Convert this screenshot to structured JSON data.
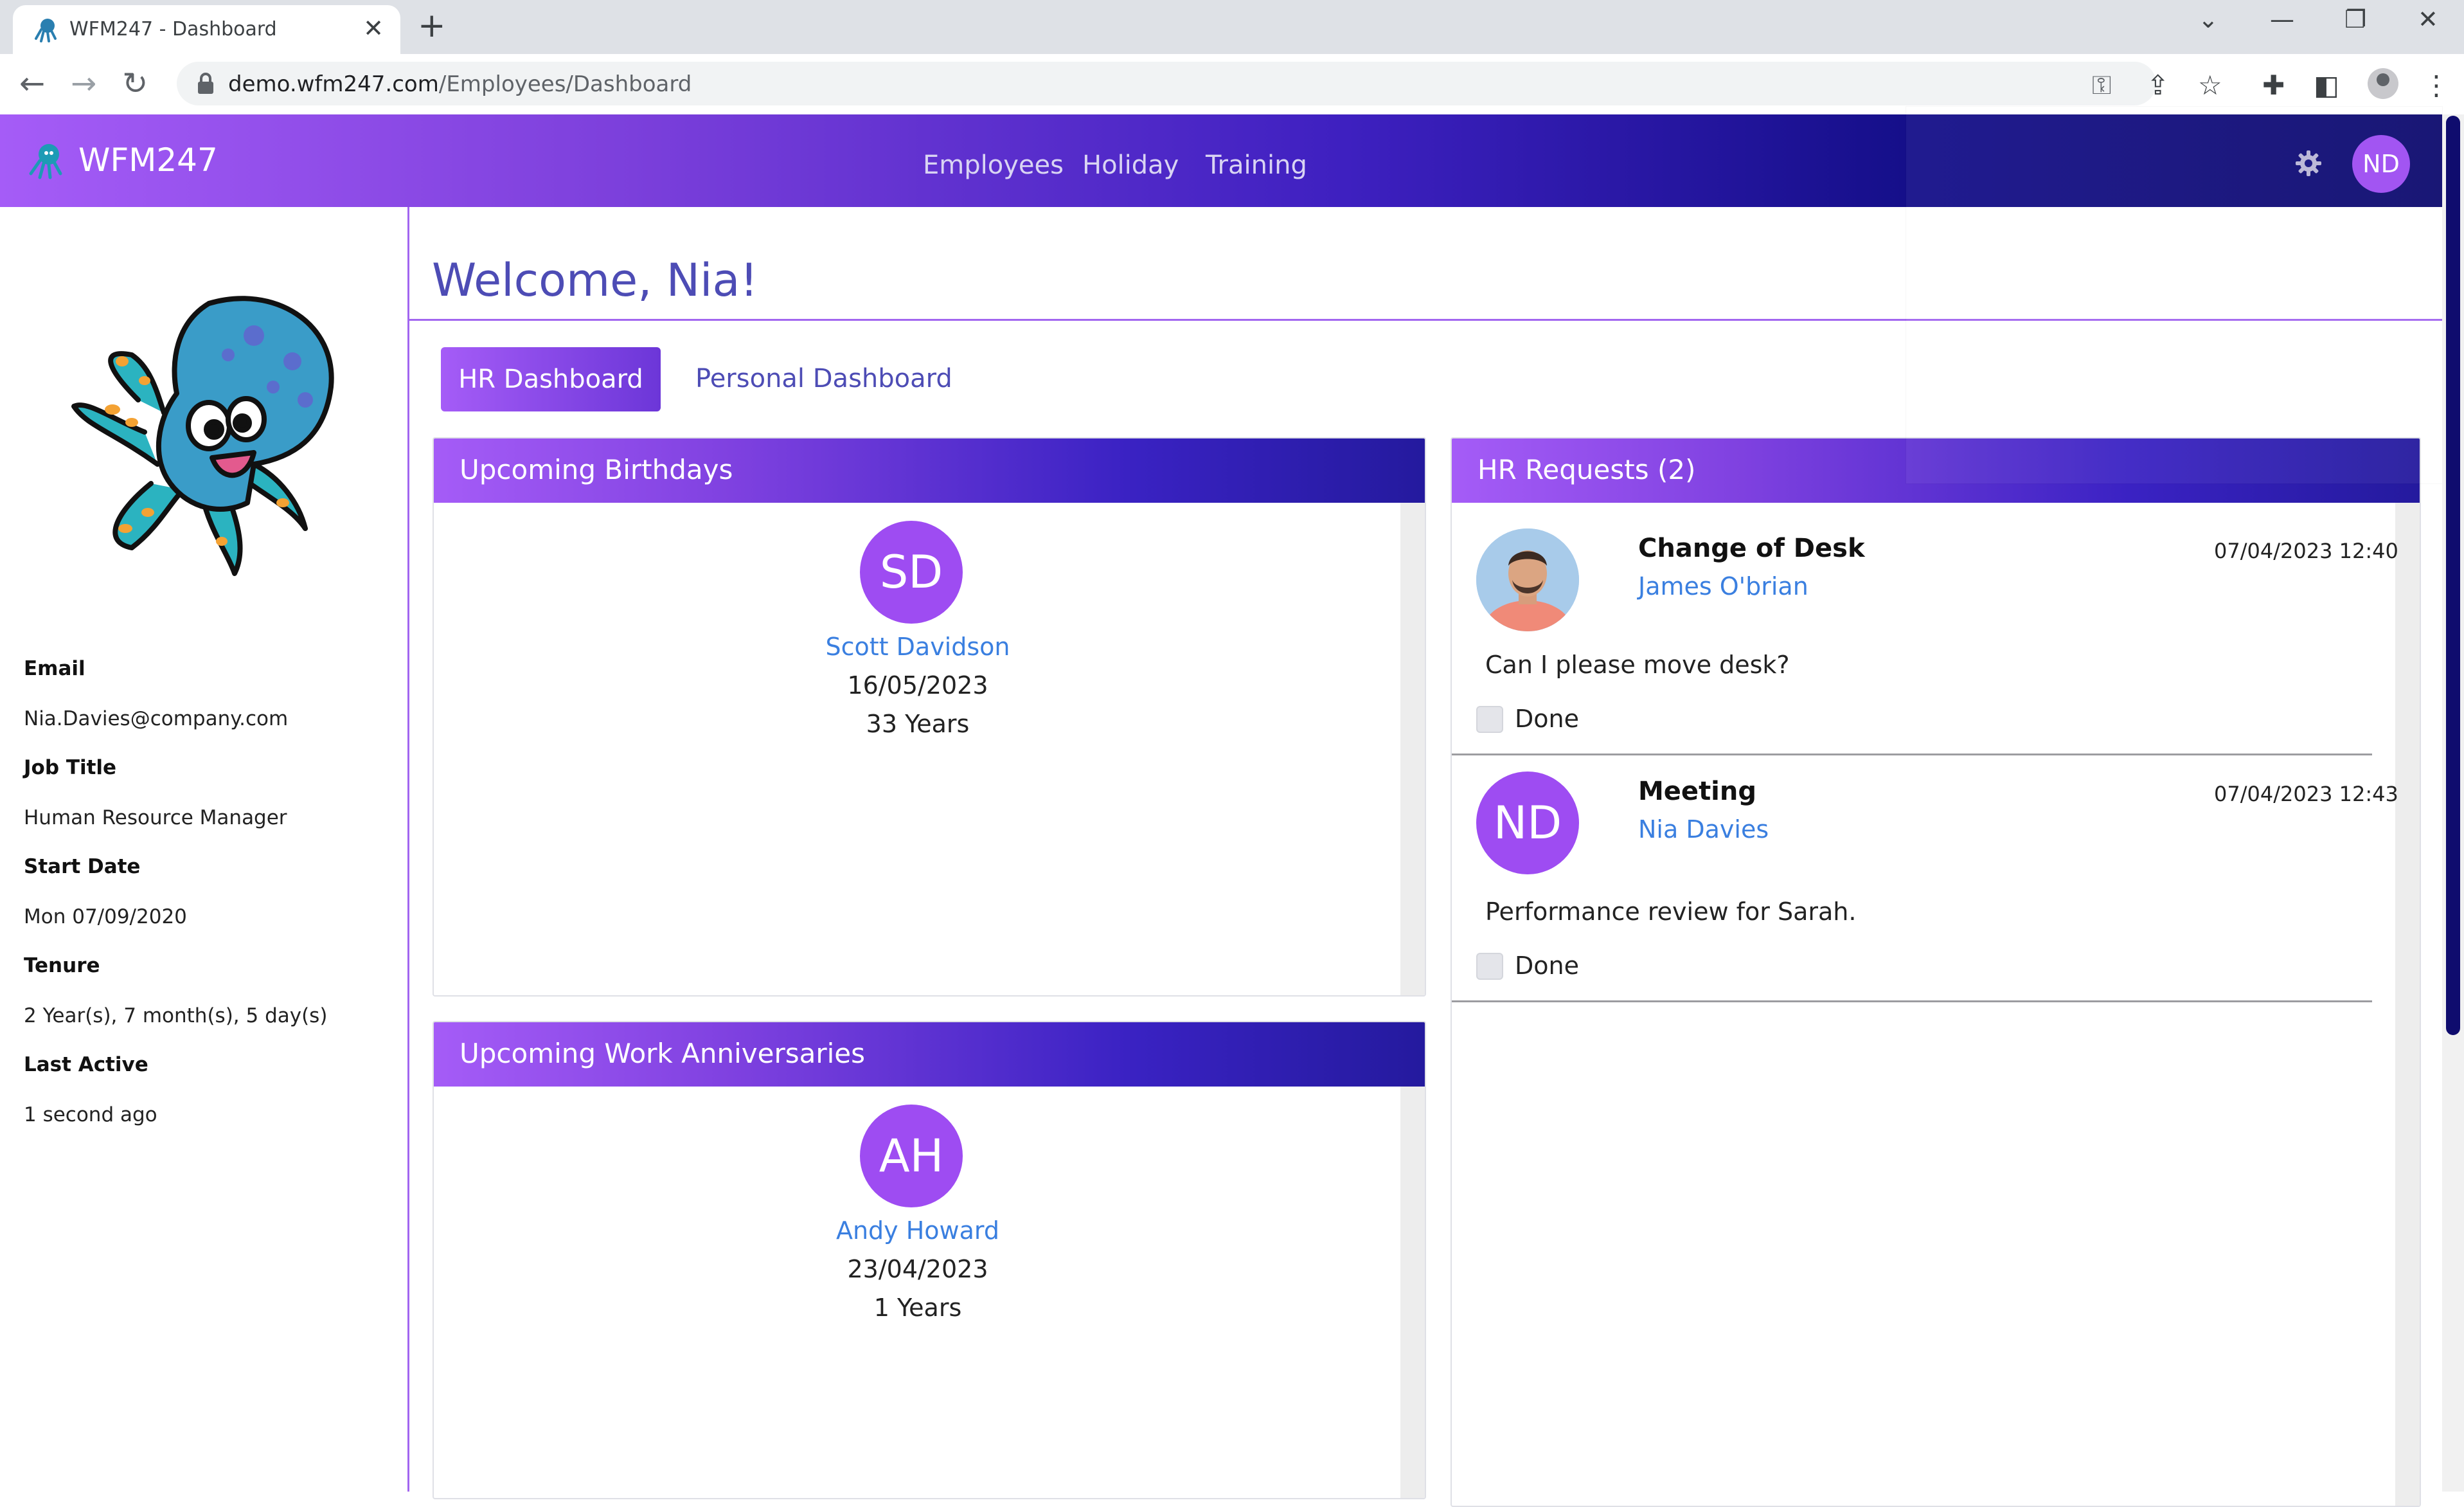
{
  "browser": {
    "tab_title": "WFM247 - Dashboard",
    "tab_close": "✕",
    "new_tab": "+",
    "win_min": "—",
    "win_restore": "❐",
    "win_close": "✕",
    "win_dropdown": "⌄",
    "back": "←",
    "forward": "→",
    "reload": "↻",
    "url_host": "demo.wfm247.com",
    "url_path": "/Employees/Dashboard",
    "key_icon": "⚿",
    "share_icon": "⇪",
    "star_icon": "☆",
    "puzzle_icon": "✚",
    "sidepanel_icon": "◧",
    "menu_icon": "⋮"
  },
  "navbar": {
    "brand": "WFM247",
    "links": [
      "Employees",
      "Holiday",
      "Training"
    ],
    "avatar_initials": "ND"
  },
  "sidebar": {
    "fields": [
      {
        "label": "Email",
        "value": "Nia.Davies@company.com"
      },
      {
        "label": "Job Title",
        "value": "Human Resource Manager"
      },
      {
        "label": "Start Date",
        "value": "Mon 07/09/2020"
      },
      {
        "label": "Tenure",
        "value": "2 Year(s), 7 month(s), 5 day(s)"
      },
      {
        "label": "Last Active",
        "value": "1 second ago"
      }
    ]
  },
  "main": {
    "welcome": "Welcome, Nia!",
    "tabs": [
      "HR Dashboard",
      "Personal Dashboard"
    ],
    "birthdays": {
      "title": "Upcoming Birthdays",
      "items": [
        {
          "initials": "SD",
          "name": "Scott Davidson",
          "date": "16/05/2023",
          "years": "33 Years"
        }
      ]
    },
    "anniversaries": {
      "title": "Upcoming Work Anniversaries",
      "items": [
        {
          "initials": "AH",
          "name": "Andy Howard",
          "date": "23/04/2023",
          "years": "1 Years"
        }
      ]
    },
    "hr_requests": {
      "title": "HR Requests (2)",
      "items": [
        {
          "title": "Change of Desk",
          "name": "James O'brian",
          "time": "07/04/2023 12:40",
          "message": "Can I please move desk?",
          "done_label": "Done"
        },
        {
          "title": "Meeting",
          "name": "Nia Davies",
          "initials": "ND",
          "time": "07/04/2023 12:43",
          "message": "Performance review for Sarah.",
          "done_label": "Done"
        }
      ]
    }
  },
  "colors": {
    "accent_purple": "#a55cf7",
    "navy": "#0d0b6e",
    "link_blue": "#3a7fe0",
    "heading_blue": "#4d4cb5"
  }
}
